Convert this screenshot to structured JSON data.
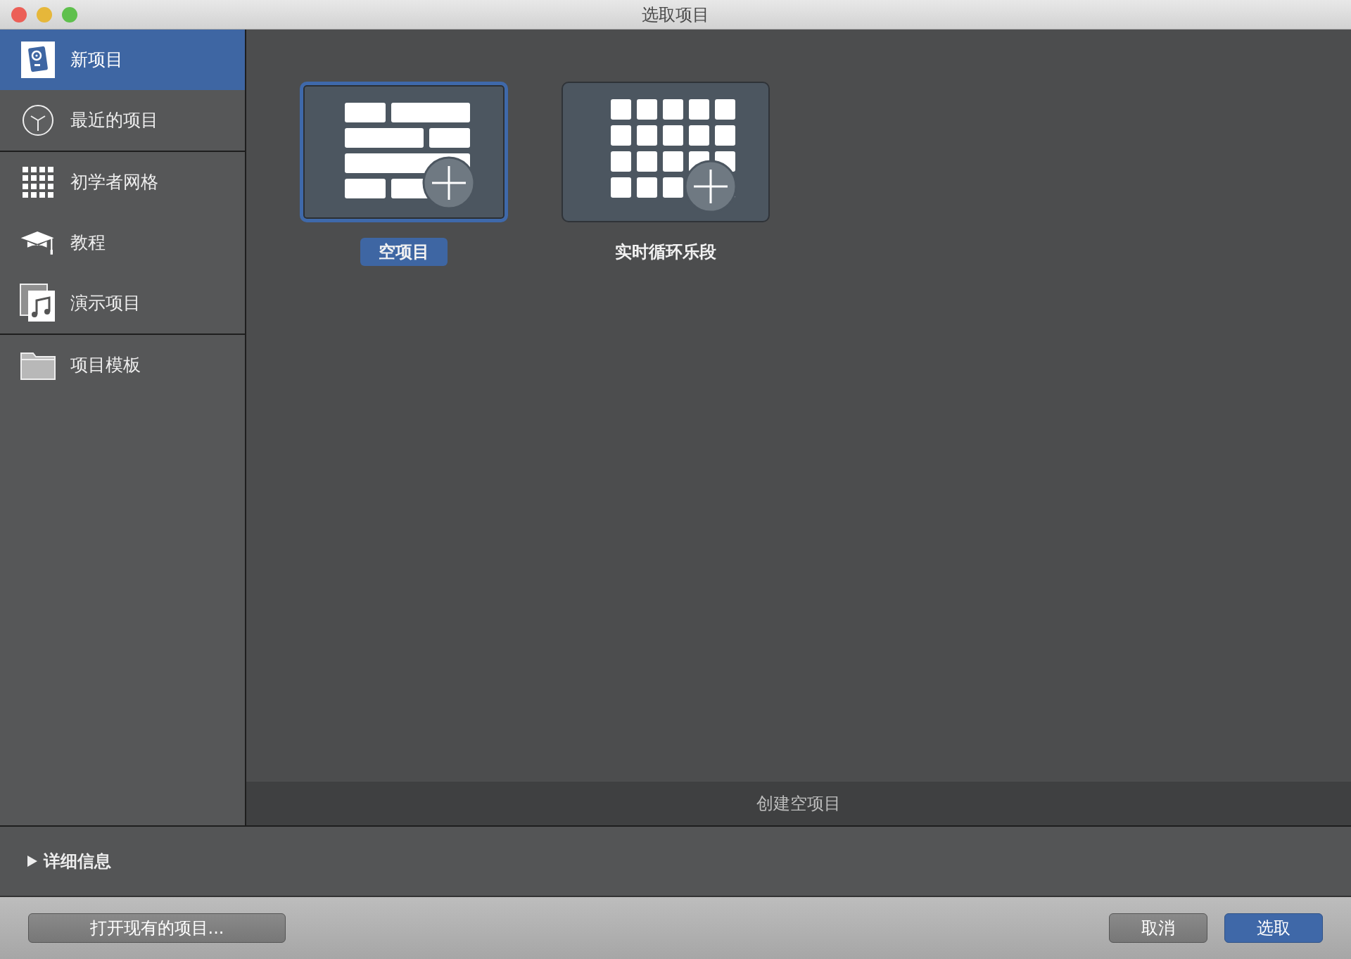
{
  "window": {
    "title": "选取项目"
  },
  "sidebar": {
    "sections": [
      {
        "items": [
          {
            "label": "新项目",
            "kind": "new",
            "selected": true
          },
          {
            "label": "最近的项目",
            "kind": "recent",
            "selected": false
          }
        ]
      },
      {
        "items": [
          {
            "label": "初学者网格",
            "kind": "grid",
            "selected": false
          },
          {
            "label": "教程",
            "kind": "tutorial",
            "selected": false
          },
          {
            "label": "演示项目",
            "kind": "demo",
            "selected": false
          }
        ]
      },
      {
        "items": [
          {
            "label": "项目模板",
            "kind": "folder",
            "selected": false
          }
        ]
      }
    ]
  },
  "templates": [
    {
      "label": "空项目",
      "kind": "tracks",
      "selected": true
    },
    {
      "label": "实时循环乐段",
      "kind": "cells",
      "selected": false
    }
  ],
  "description": "创建空项目",
  "details": {
    "label": "详细信息",
    "expanded": false
  },
  "buttons": [
    {
      "label": "打开现有的项目...",
      "kind": "secondary"
    },
    {
      "label": "取消",
      "kind": "cancel"
    },
    {
      "label": "选取",
      "kind": "default"
    }
  ]
}
